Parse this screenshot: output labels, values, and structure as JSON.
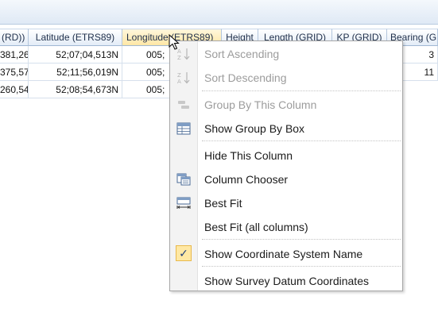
{
  "grid": {
    "columns": [
      "(RD))",
      "Latitude (ETRS89)",
      "Longitude (ETRS89)",
      "Height",
      "Length (GRID)",
      "KP (GRID)",
      "Bearing (G"
    ],
    "rows": [
      [
        "381,26",
        "52;07;04,513N",
        "005;",
        "",
        "",
        "",
        "3"
      ],
      [
        "375,57",
        "52;11;56,019N",
        "005;",
        "",
        "",
        "",
        "11"
      ],
      [
        "260,54",
        "52;08;54,673N",
        "005;",
        "",
        "",
        "",
        ""
      ]
    ]
  },
  "context_menu": {
    "items": [
      {
        "label": "Sort Ascending",
        "icon": "sort-ascending-icon",
        "enabled": false
      },
      {
        "label": "Sort Descending",
        "icon": "sort-descending-icon",
        "enabled": false
      },
      {
        "label": "Group By This Column",
        "icon": "group-by-icon",
        "enabled": false
      },
      {
        "label": "Show Group By Box",
        "icon": "group-by-box-icon",
        "enabled": true
      },
      {
        "label": "Hide This Column",
        "icon": "",
        "enabled": true
      },
      {
        "label": "Column Chooser",
        "icon": "column-chooser-icon",
        "enabled": true
      },
      {
        "label": "Best Fit",
        "icon": "best-fit-icon",
        "enabled": true
      },
      {
        "label": "Best Fit (all columns)",
        "icon": "",
        "enabled": true
      },
      {
        "label": "Show Coordinate System Name",
        "icon": "checkmark-icon",
        "enabled": true,
        "checked": true
      },
      {
        "label": "Show Survey Datum Coordinates",
        "icon": "",
        "enabled": true
      }
    ]
  },
  "colors": {
    "header_hot": "#ffe7a6",
    "check_highlight": "#ffe8a4",
    "disabled_text": "#9c9c9c"
  }
}
